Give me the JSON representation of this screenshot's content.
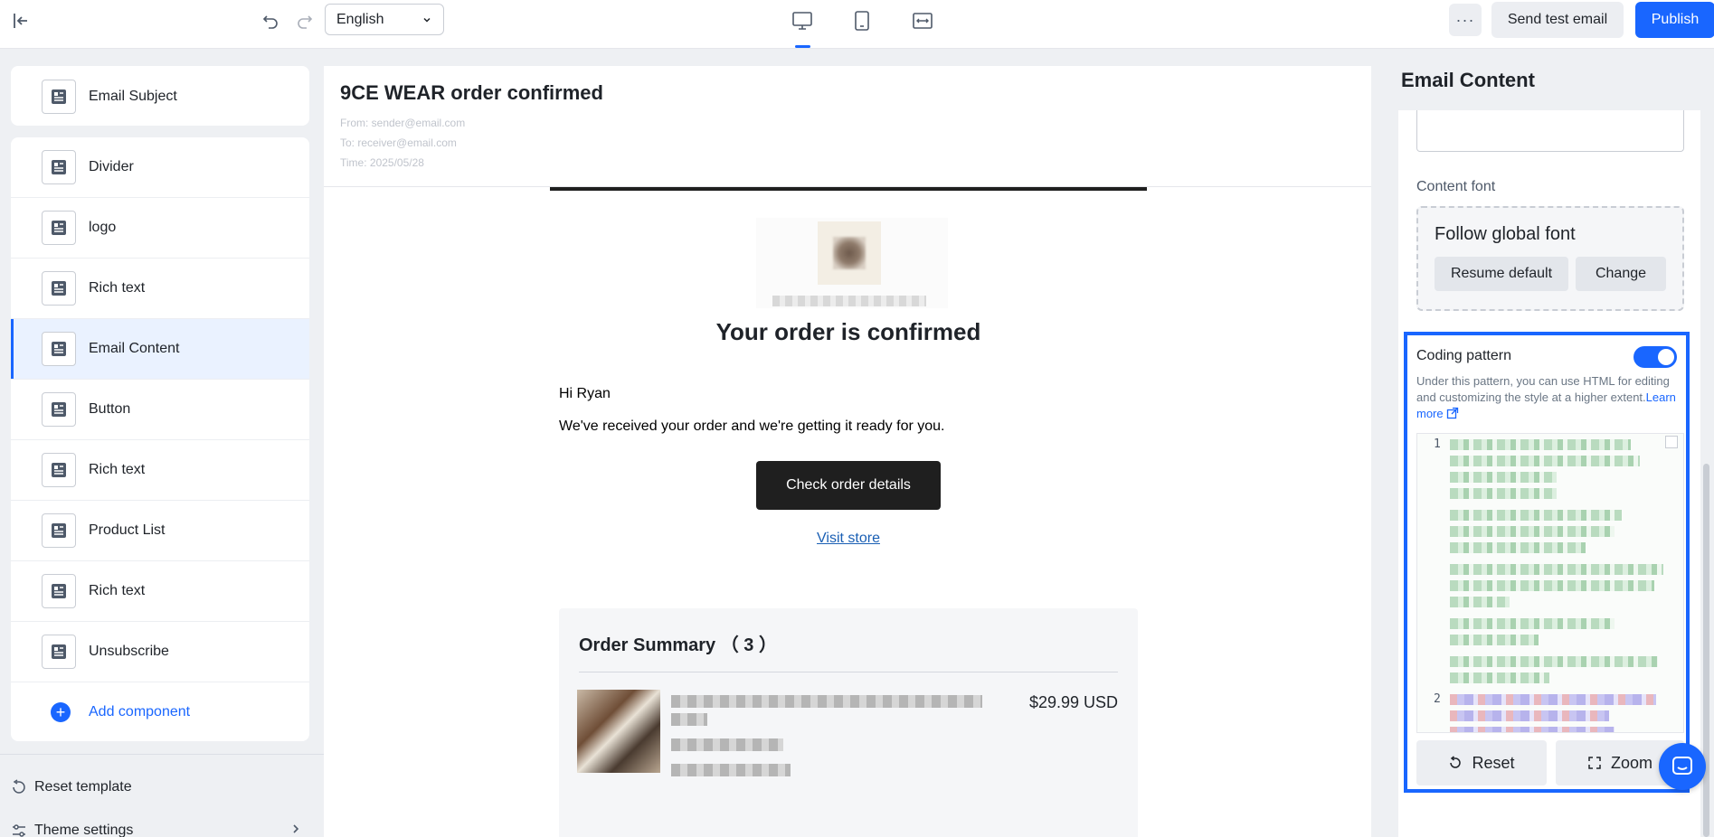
{
  "toolbar": {
    "language": "English",
    "send_test_label": "Send test email",
    "publish_label": "Publish",
    "more_label": "···"
  },
  "components": {
    "subject": {
      "label": "Email Subject",
      "icon": "block-icon"
    },
    "items": [
      {
        "label": "Divider"
      },
      {
        "label": "logo"
      },
      {
        "label": "Rich text"
      },
      {
        "label": "Email Content",
        "active": true
      },
      {
        "label": "Button"
      },
      {
        "label": "Rich text"
      },
      {
        "label": "Product List"
      },
      {
        "label": "Rich text"
      },
      {
        "label": "Unsubscribe"
      }
    ],
    "add_label": "Add component"
  },
  "footer": {
    "reset_label": "Reset template",
    "theme_label": "Theme settings"
  },
  "email": {
    "title": "9CE WEAR order confirmed",
    "from": "From: sender@email.com",
    "to": "To: receiver@email.com",
    "time": "Time: 2025/05/28",
    "headline": "Your order is confirmed",
    "greeting": "Hi Ryan",
    "message": "We've received your order and we're getting it ready for you.",
    "cta_label": "Check order details",
    "visit_store": "Visit store",
    "summary_title": "Order Summary （ 3 ）",
    "product_price": "$29.99 USD"
  },
  "settings": {
    "panel_title": "Email Content",
    "content_font_label": "Content font",
    "font_value": "Follow global font",
    "resume_default": "Resume default",
    "change": "Change",
    "coding_label": "Coding pattern",
    "coding_enabled": true,
    "coding_desc": "Under this pattern, you can use HTML for editing and customizing the style at a higher extent.",
    "learn_more": "Learn more",
    "line_1": "1",
    "line_2": "2",
    "reset_btn": "Reset",
    "zoom_btn": "Zoom"
  },
  "colors": {
    "accent": "#1966ff",
    "cta_bg": "#1f1f1f",
    "link": "#1a5fb4"
  }
}
